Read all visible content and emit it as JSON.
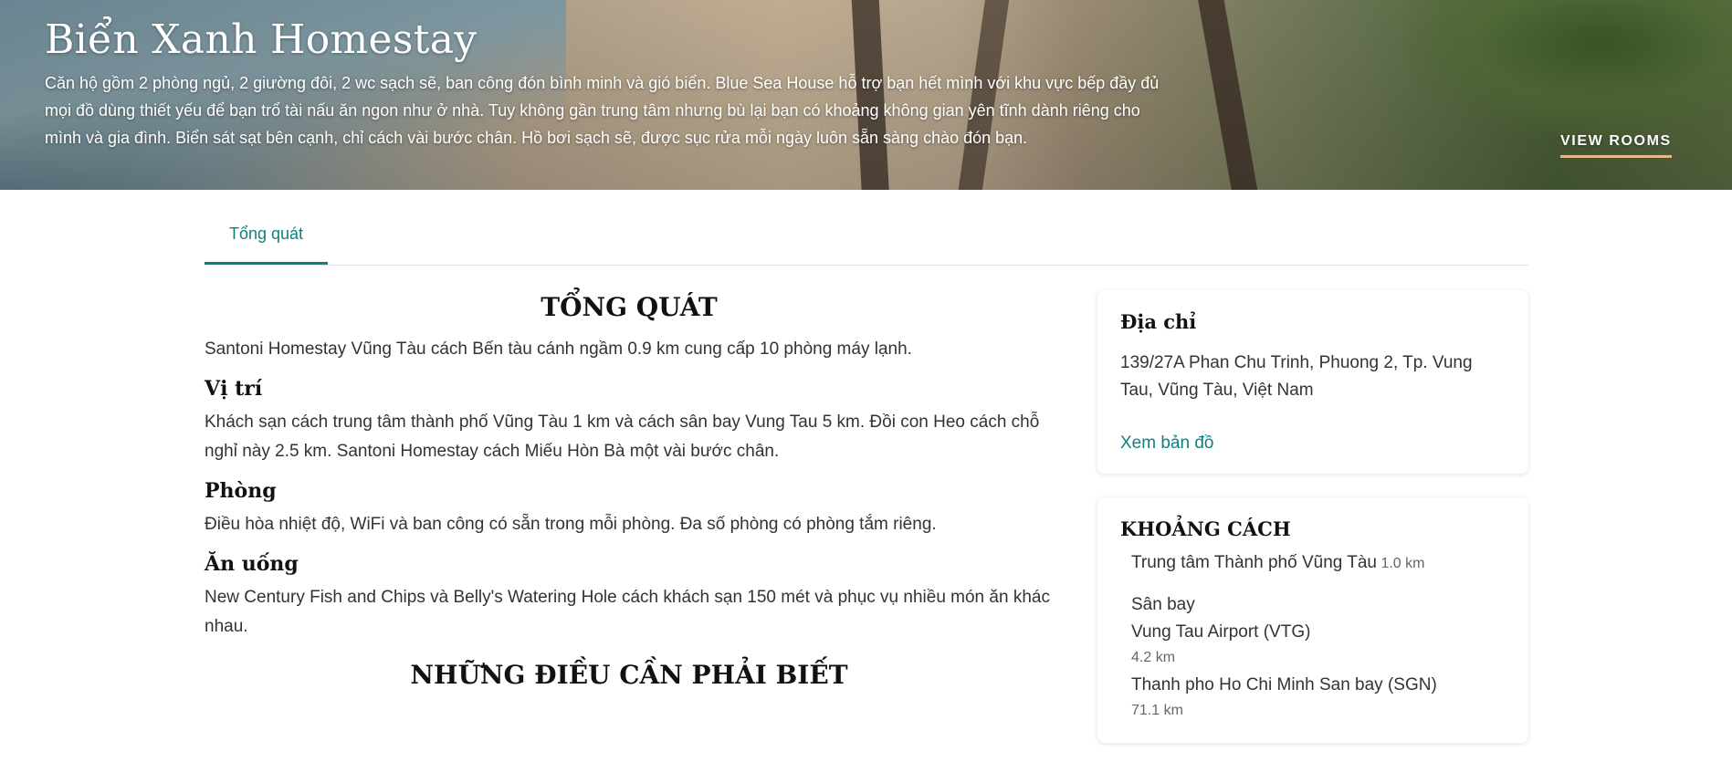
{
  "hero": {
    "title": "Biển Xanh Homestay",
    "description": "Căn hộ gồm 2 phòng ngủ, 2 giường đôi, 2 wc sạch sẽ, ban công đón bình minh và gió biển. Blue Sea House hỗ trợ bạn hết mình với khu vực bếp đầy đủ mọi đồ dùng thiết yếu để bạn trổ tài nấu ăn ngon như ở nhà. Tuy không gần trung tâm nhưng bù lại bạn có khoảng không gian yên tĩnh dành riêng cho mình và gia đình. Biển sát sạt bên cạnh, chỉ cách vài bước chân. Hồ bơi sạch sẽ, được sục rửa mỗi ngày luôn sẵn sàng chào đón bạn.",
    "cta": "VIEW ROOMS"
  },
  "tabs": [
    {
      "label": "Tổng quát"
    }
  ],
  "overview": {
    "heading": "TỔNG QUÁT",
    "intro": "Santoni Homestay Vũng Tàu cách Bến tàu cánh ngầm 0.9 km cung cấp 10 phòng máy lạnh.",
    "sections": [
      {
        "title": "Vị trí",
        "text": "Khách sạn cách trung tâm thành phố Vũng Tàu 1 km và cách sân bay Vung Tau 5 km. Đồi con Heo cách chỗ nghỉ này 2.5 km. Santoni Homestay cách Miếu Hòn Bà một vài bước chân."
      },
      {
        "title": "Phòng",
        "text": "Điều hòa nhiệt độ, WiFi và ban công có sẵn trong mỗi phòng. Đa số phòng có phòng tắm riêng."
      },
      {
        "title": "Ăn uống",
        "text": "New Century Fish and Chips và Belly's Watering Hole cách khách sạn 150 mét và phục vụ nhiều món ăn khác nhau."
      }
    ],
    "heading2": "NHỮNG ĐIỀU CẦN PHẢI BIẾT"
  },
  "address_card": {
    "title": "Địa chỉ",
    "address": "139/27A Phan Chu Trinh, Phuong 2, Tp. Vung Tau, Vũng Tàu, Việt Nam",
    "map_link": "Xem bản đồ"
  },
  "distance_card": {
    "title": "KHOẢNG CÁCH",
    "items": [
      {
        "name": "Trung tâm Thành phố Vũng Tàu",
        "distance": "1.0 km"
      },
      {
        "name": "Sân bay",
        "name2": "Vung Tau Airport (VTG)",
        "distance": "4.2 km"
      },
      {
        "name": "Thanh pho Ho Chi Minh San bay (SGN)",
        "distance": "71.1 km"
      }
    ]
  }
}
